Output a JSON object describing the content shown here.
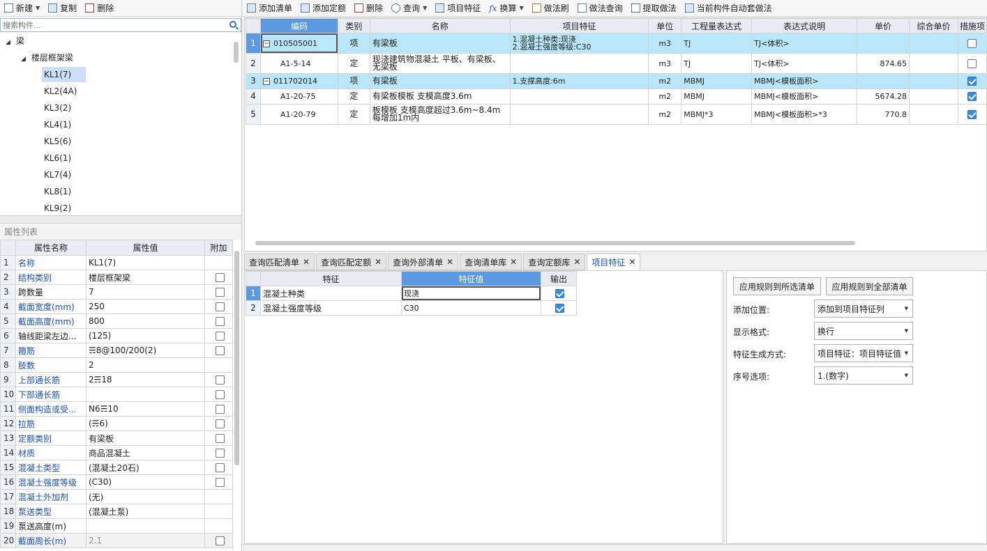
{
  "left_toolbar": {
    "new": "新建",
    "copy": "复制",
    "delete": "删除"
  },
  "search": {
    "placeholder": "搜索构件..."
  },
  "tree": {
    "root": "梁",
    "group": "楼层框架梁",
    "items": [
      "KL1(7)",
      "KL2(4A)",
      "KL3(2)",
      "KL4(1)",
      "KL5(6)",
      "KL6(1)",
      "KL7(4)",
      "KL8(1)",
      "KL9(2)"
    ]
  },
  "props": {
    "header": "属性列表",
    "cols": [
      "属性名称",
      "属性值",
      "附加"
    ],
    "rows": [
      {
        "n": "1",
        "name": "名称",
        "value": "KL1(7)",
        "blue": true,
        "check": false
      },
      {
        "n": "2",
        "name": "结构类别",
        "value": "楼层框架梁",
        "blue": true,
        "check": true
      },
      {
        "n": "3",
        "name": "跨数量",
        "value": "7",
        "blue": false,
        "check": true
      },
      {
        "n": "4",
        "name": "截面宽度(mm)",
        "value": "250",
        "blue": true,
        "check": true
      },
      {
        "n": "5",
        "name": "截面高度(mm)",
        "value": "800",
        "blue": true,
        "check": true
      },
      {
        "n": "6",
        "name": "轴线距梁左边...",
        "value": "(125)",
        "blue": false,
        "check": true
      },
      {
        "n": "7",
        "name": "箍筋",
        "value": "☴8@100/200(2)",
        "blue": true,
        "check": true
      },
      {
        "n": "8",
        "name": "肢数",
        "value": "2",
        "blue": true,
        "check": false
      },
      {
        "n": "9",
        "name": "上部通长筋",
        "value": "2☴18",
        "blue": true,
        "check": true
      },
      {
        "n": "10",
        "name": "下部通长筋",
        "value": "",
        "blue": true,
        "check": true
      },
      {
        "n": "11",
        "name": "侧面构造或受...",
        "value": "N6☴10",
        "blue": true,
        "check": true
      },
      {
        "n": "12",
        "name": "拉筋",
        "value": "(☴6)",
        "blue": true,
        "check": true
      },
      {
        "n": "13",
        "name": "定额类别",
        "value": "有梁板",
        "blue": true,
        "check": true
      },
      {
        "n": "14",
        "name": "材质",
        "value": "商品混凝土",
        "blue": true,
        "check": true
      },
      {
        "n": "15",
        "name": "混凝土类型",
        "value": "(混凝土20石)",
        "blue": true,
        "check": true
      },
      {
        "n": "16",
        "name": "混凝土强度等级",
        "value": "(C30)",
        "blue": true,
        "check": true
      },
      {
        "n": "17",
        "name": "混凝土外加剂",
        "value": "(无)",
        "blue": true,
        "check": false
      },
      {
        "n": "18",
        "name": "泵送类型",
        "value": "(混凝土泵)",
        "blue": true,
        "check": false
      },
      {
        "n": "19",
        "name": "泵送高度(m)",
        "value": "",
        "blue": false,
        "check": false
      },
      {
        "n": "20",
        "name": "截面周长(m)",
        "value": "2.1",
        "blue": true,
        "check": true
      }
    ]
  },
  "main_toolbar": {
    "add_list": "添加清单",
    "add_quota": "添加定额",
    "delete": "删除",
    "query": "查询",
    "item_feature": "项目特征",
    "convert": "换算",
    "method_brush": "做法刷",
    "method_query": "做法查询",
    "extract": "提取做法",
    "auto_apply": "当前构件自动套做法"
  },
  "grid": {
    "cols": [
      "编码",
      "类别",
      "名称",
      "项目特征",
      "单位",
      "工程量表达式",
      "表达式说明",
      "单价",
      "综合单价",
      "措施项"
    ],
    "rows": [
      {
        "n": "1",
        "code": "010505001",
        "type": "项",
        "name": "有梁板",
        "feature": "1.混凝土种类:现浇\n2.混凝土强度等级:C30",
        "unit": "m3",
        "expr": "TJ",
        "desc": "TJ<体积>",
        "price": "",
        "check": false,
        "xm": true
      },
      {
        "n": "2",
        "code": "A1-5-14",
        "type": "定",
        "name": "现浇建筑物混凝土 平板、有梁板、无梁板",
        "feature": "",
        "unit": "m3",
        "expr": "TJ",
        "desc": "TJ<体积>",
        "price": "874.65",
        "check": false,
        "xm": false
      },
      {
        "n": "3",
        "code": "011702014",
        "type": "项",
        "name": "有梁板",
        "feature": "1.支撑高度:6m",
        "unit": "m2",
        "expr": "MBMJ",
        "desc": "MBMJ<模板面积>",
        "price": "",
        "check": true,
        "xm": true
      },
      {
        "n": "4",
        "code": "A1-20-75",
        "type": "定",
        "name": "有梁板模板 支模高度3.6m",
        "feature": "",
        "unit": "m2",
        "expr": "MBMJ",
        "desc": "MBMJ<模板面积>",
        "price": "5674.28",
        "check": true,
        "xm": false
      },
      {
        "n": "5",
        "code": "A1-20-79",
        "type": "定",
        "name": "板模板 支模高度超过3.6m~8.4m 每增加1m内",
        "feature": "",
        "unit": "m2",
        "expr": "MBMJ*3",
        "desc": "MBMJ<模板面积>*3",
        "price": "770.8",
        "check": true,
        "xm": false
      }
    ]
  },
  "tabs": [
    "查询匹配清单",
    "查询匹配定额",
    "查询外部清单",
    "查询清单库",
    "查询定额库",
    "项目特征"
  ],
  "features": {
    "cols": [
      "特征",
      "特征值",
      "输出"
    ],
    "rows": [
      {
        "n": "1",
        "name": "混凝土种类",
        "value": "现浇",
        "out": true
      },
      {
        "n": "2",
        "name": "混凝土强度等级",
        "value": "C30",
        "out": true
      }
    ]
  },
  "options": {
    "apply_selected": "应用规则到所选清单",
    "apply_all": "应用规则到全部清单",
    "add_pos_label": "添加位置:",
    "add_pos": "添加到项目特征列",
    "format_label": "显示格式:",
    "format": "换行",
    "gen_label": "特征生成方式:",
    "gen": "项目特征：项目特征值",
    "seq_label": "序号选项:",
    "seq": "1.(数字)"
  }
}
